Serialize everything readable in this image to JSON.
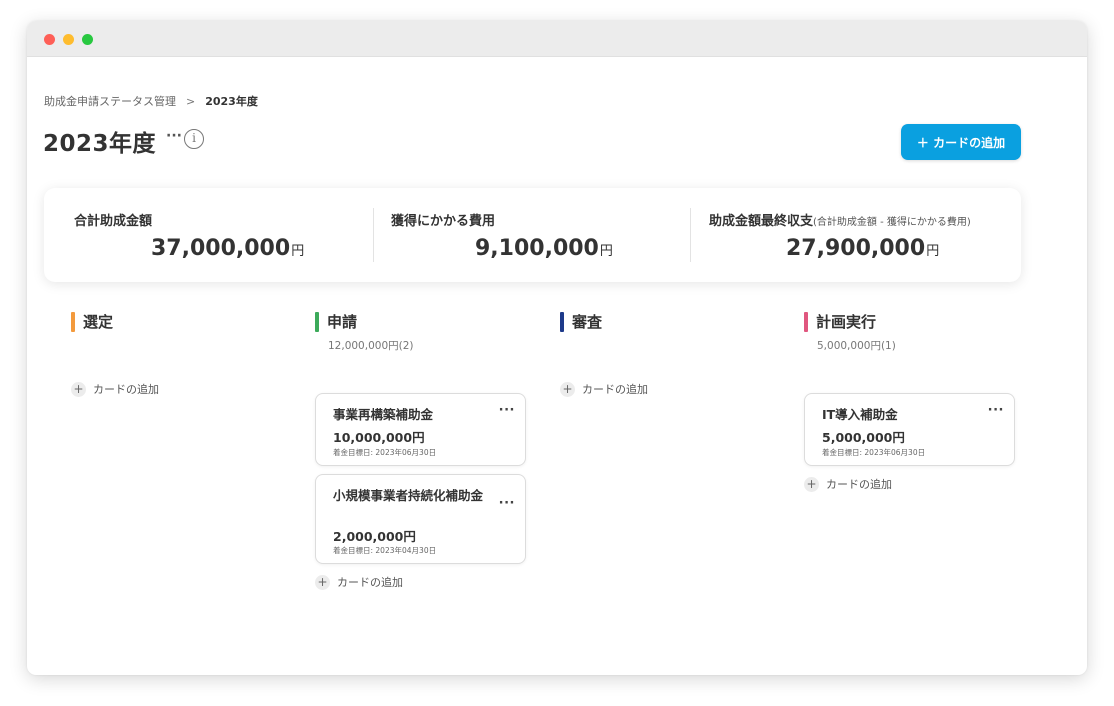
{
  "breadcrumb": {
    "parent": "助成金申請ステータス管理",
    "separator": ">",
    "current": "2023年度"
  },
  "page": {
    "title": "2023年度",
    "more": "···",
    "info": "i"
  },
  "actions": {
    "add_card_label": "＋ カードの追加"
  },
  "summary": {
    "total": {
      "label": "合計助成金額",
      "value": "37,000,000",
      "unit": "円"
    },
    "cost": {
      "label": "獲得にかかる費用",
      "value": "9,100,000",
      "unit": "円"
    },
    "net": {
      "label": "助成金額最終収支",
      "sub": "(合計助成金額 - 獲得にかかる費用)",
      "value": "27,900,000",
      "unit": "円"
    }
  },
  "columns": [
    {
      "title": "選定",
      "color": "#f39a3d",
      "total": "",
      "add_label": "カードの追加",
      "cards": []
    },
    {
      "title": "申請",
      "color": "#3caa5a",
      "total": "12,000,000円(2)",
      "add_label": "カードの追加",
      "cards": [
        {
          "title": "事業再構築補助金",
          "amount": "10,000,000円",
          "date": "着金目標日: 2023年06月30日"
        },
        {
          "title": "小規模事業者持続化補助金",
          "amount": "2,000,000円",
          "date": "着金目標日: 2023年04月30日"
        }
      ]
    },
    {
      "title": "審査",
      "color": "#1e3a8a",
      "total": "",
      "add_label": "カードの追加",
      "cards": []
    },
    {
      "title": "計画実行",
      "color": "#e0577f",
      "total": "5,000,000円(1)",
      "add_label": "カードの追加",
      "cards": [
        {
          "title": "IT導入補助金",
          "amount": "5,000,000円",
          "date": "着金目標日: 2023年06月30日"
        }
      ]
    }
  ],
  "card_more": "···",
  "plus": "+",
  "colors": {
    "primary": "#0aa0e0"
  }
}
